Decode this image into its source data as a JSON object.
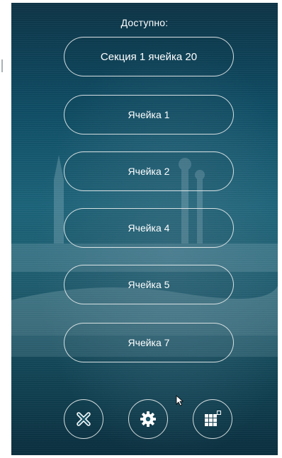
{
  "header": {
    "title": "Доступно:"
  },
  "cells": [
    {
      "label": "Секция 1 ячейка 20"
    },
    {
      "label": "Ячейка 1"
    },
    {
      "label": "Ячейка 2"
    },
    {
      "label": "Ячейка 4"
    },
    {
      "label": "Ячейка 5"
    },
    {
      "label": "Ячейка 7"
    }
  ],
  "actions": {
    "cancel": {
      "icon": "close-icon"
    },
    "settings": {
      "icon": "gear-icon"
    },
    "keypad": {
      "icon": "keypad-icon"
    }
  },
  "colors": {
    "background_top": "#0c3346",
    "background_mid": "#1a6379",
    "text": "#ffffff",
    "outline": "#ebf0f0"
  }
}
